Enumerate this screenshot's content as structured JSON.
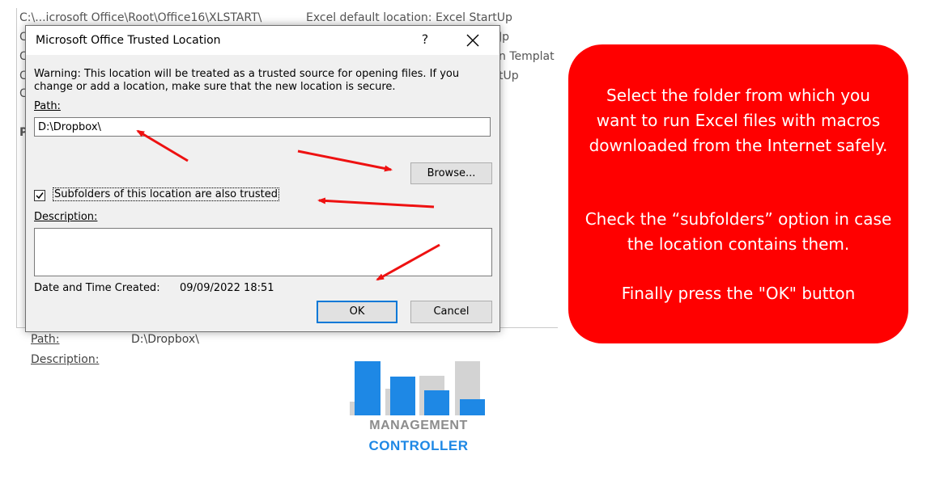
{
  "background": {
    "row1_path": "C:\\...icrosoft Office\\Root\\Office16\\XLSTART\\",
    "row1_desc": "Excel default location: Excel StartUp",
    "row2_frag": "Jp",
    "row3_frag": "n Templat",
    "row4_frag": "tUp",
    "letters": [
      "C",
      "C",
      "C",
      "C",
      "P"
    ],
    "path_label": "Path:",
    "path_value": "D:\\Dropbox\\",
    "description_label": "Description:"
  },
  "dialog": {
    "title": "Microsoft Office Trusted Location",
    "help_glyph": "?",
    "warning": "Warning: This location will be treated as a trusted source for opening files. If you change or add a location, make sure that the new location is secure.",
    "path_label": "Path:",
    "path_value": "D:\\Dropbox\\",
    "browse_label": "Browse...",
    "subfolders_label": "Subfolders of this location are also trusted",
    "subfolders_checked": true,
    "description_label": "Description:",
    "description_value": "",
    "date_label": "Date and Time Created:",
    "date_value": "09/09/2022 18:51",
    "ok_label": "OK",
    "cancel_label": "Cancel"
  },
  "callout": {
    "color": "#ff0000",
    "paragraph1": "Select the folder from which you want to run Excel files with macros downloaded from the Internet safely.",
    "paragraph2": "Check the “subfolders” option in case the location contains them.",
    "paragraph3": "Finally press the \"OK\" button"
  },
  "logo": {
    "line1": "MANAGEMENT",
    "line2": "CONTROLLER",
    "blue": "#1e88e5",
    "gray": "#d3d3d3"
  },
  "annotation": {
    "arrow_color": "#ee1111"
  }
}
